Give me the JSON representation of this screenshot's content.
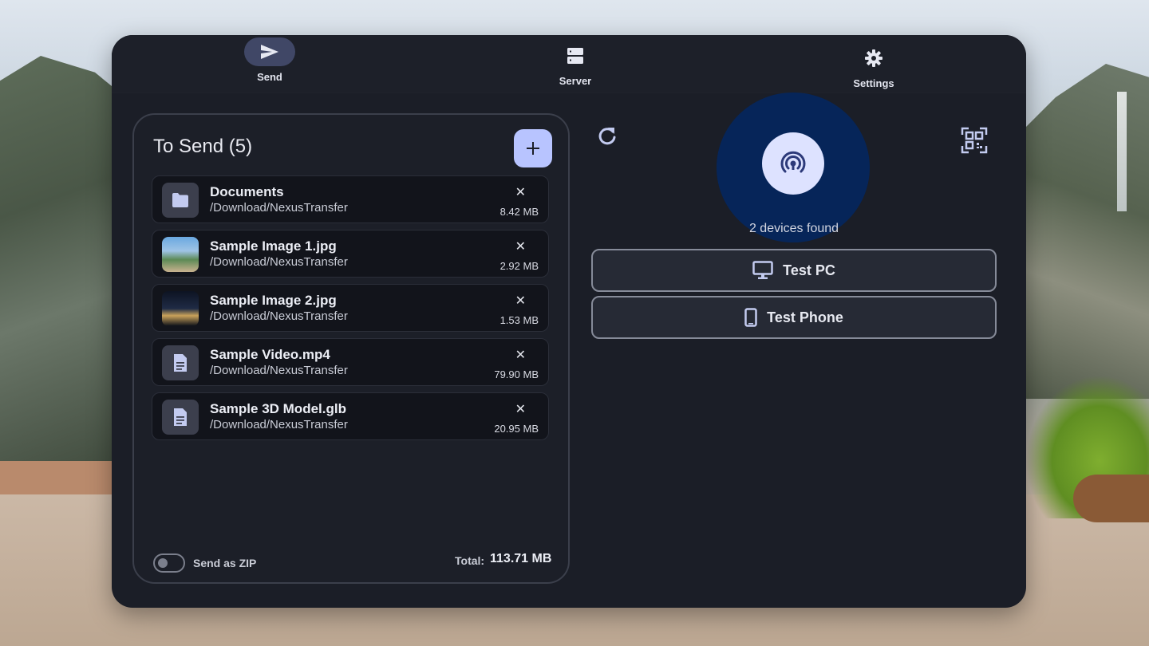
{
  "nav": {
    "send": "Send",
    "server": "Server",
    "settings": "Settings"
  },
  "send_panel": {
    "title": "To Send (5)",
    "files": [
      {
        "name": "Documents",
        "path": "/Download/NexusTransfer",
        "size": "8.42 MB",
        "icon": "folder-icon"
      },
      {
        "name": "Sample Image 1.jpg",
        "path": "/Download/NexusTransfer",
        "size": "2.92 MB",
        "icon": "image-thumbnail"
      },
      {
        "name": "Sample Image 2.jpg",
        "path": "/Download/NexusTransfer",
        "size": "1.53 MB",
        "icon": "image-thumbnail"
      },
      {
        "name": "Sample Video.mp4",
        "path": "/Download/NexusTransfer",
        "size": "79.90 MB",
        "icon": "document-icon"
      },
      {
        "name": "Sample 3D Model.glb",
        "path": "/Download/NexusTransfer",
        "size": "20.95 MB",
        "icon": "document-icon"
      }
    ],
    "close_glyph": "✕",
    "zip_label": "Send as ZIP",
    "zip_enabled": false,
    "total_label": "Total:",
    "total_value": "113.71 MB"
  },
  "devices": {
    "status": "2 devices found",
    "list": [
      {
        "label": "Test PC",
        "icon": "monitor-icon"
      },
      {
        "label": "Test Phone",
        "icon": "phone-icon"
      }
    ]
  },
  "colors": {
    "panel_bg": "#1b1e27",
    "accent": "#b8c4ff",
    "scan_circle": "#062559"
  }
}
